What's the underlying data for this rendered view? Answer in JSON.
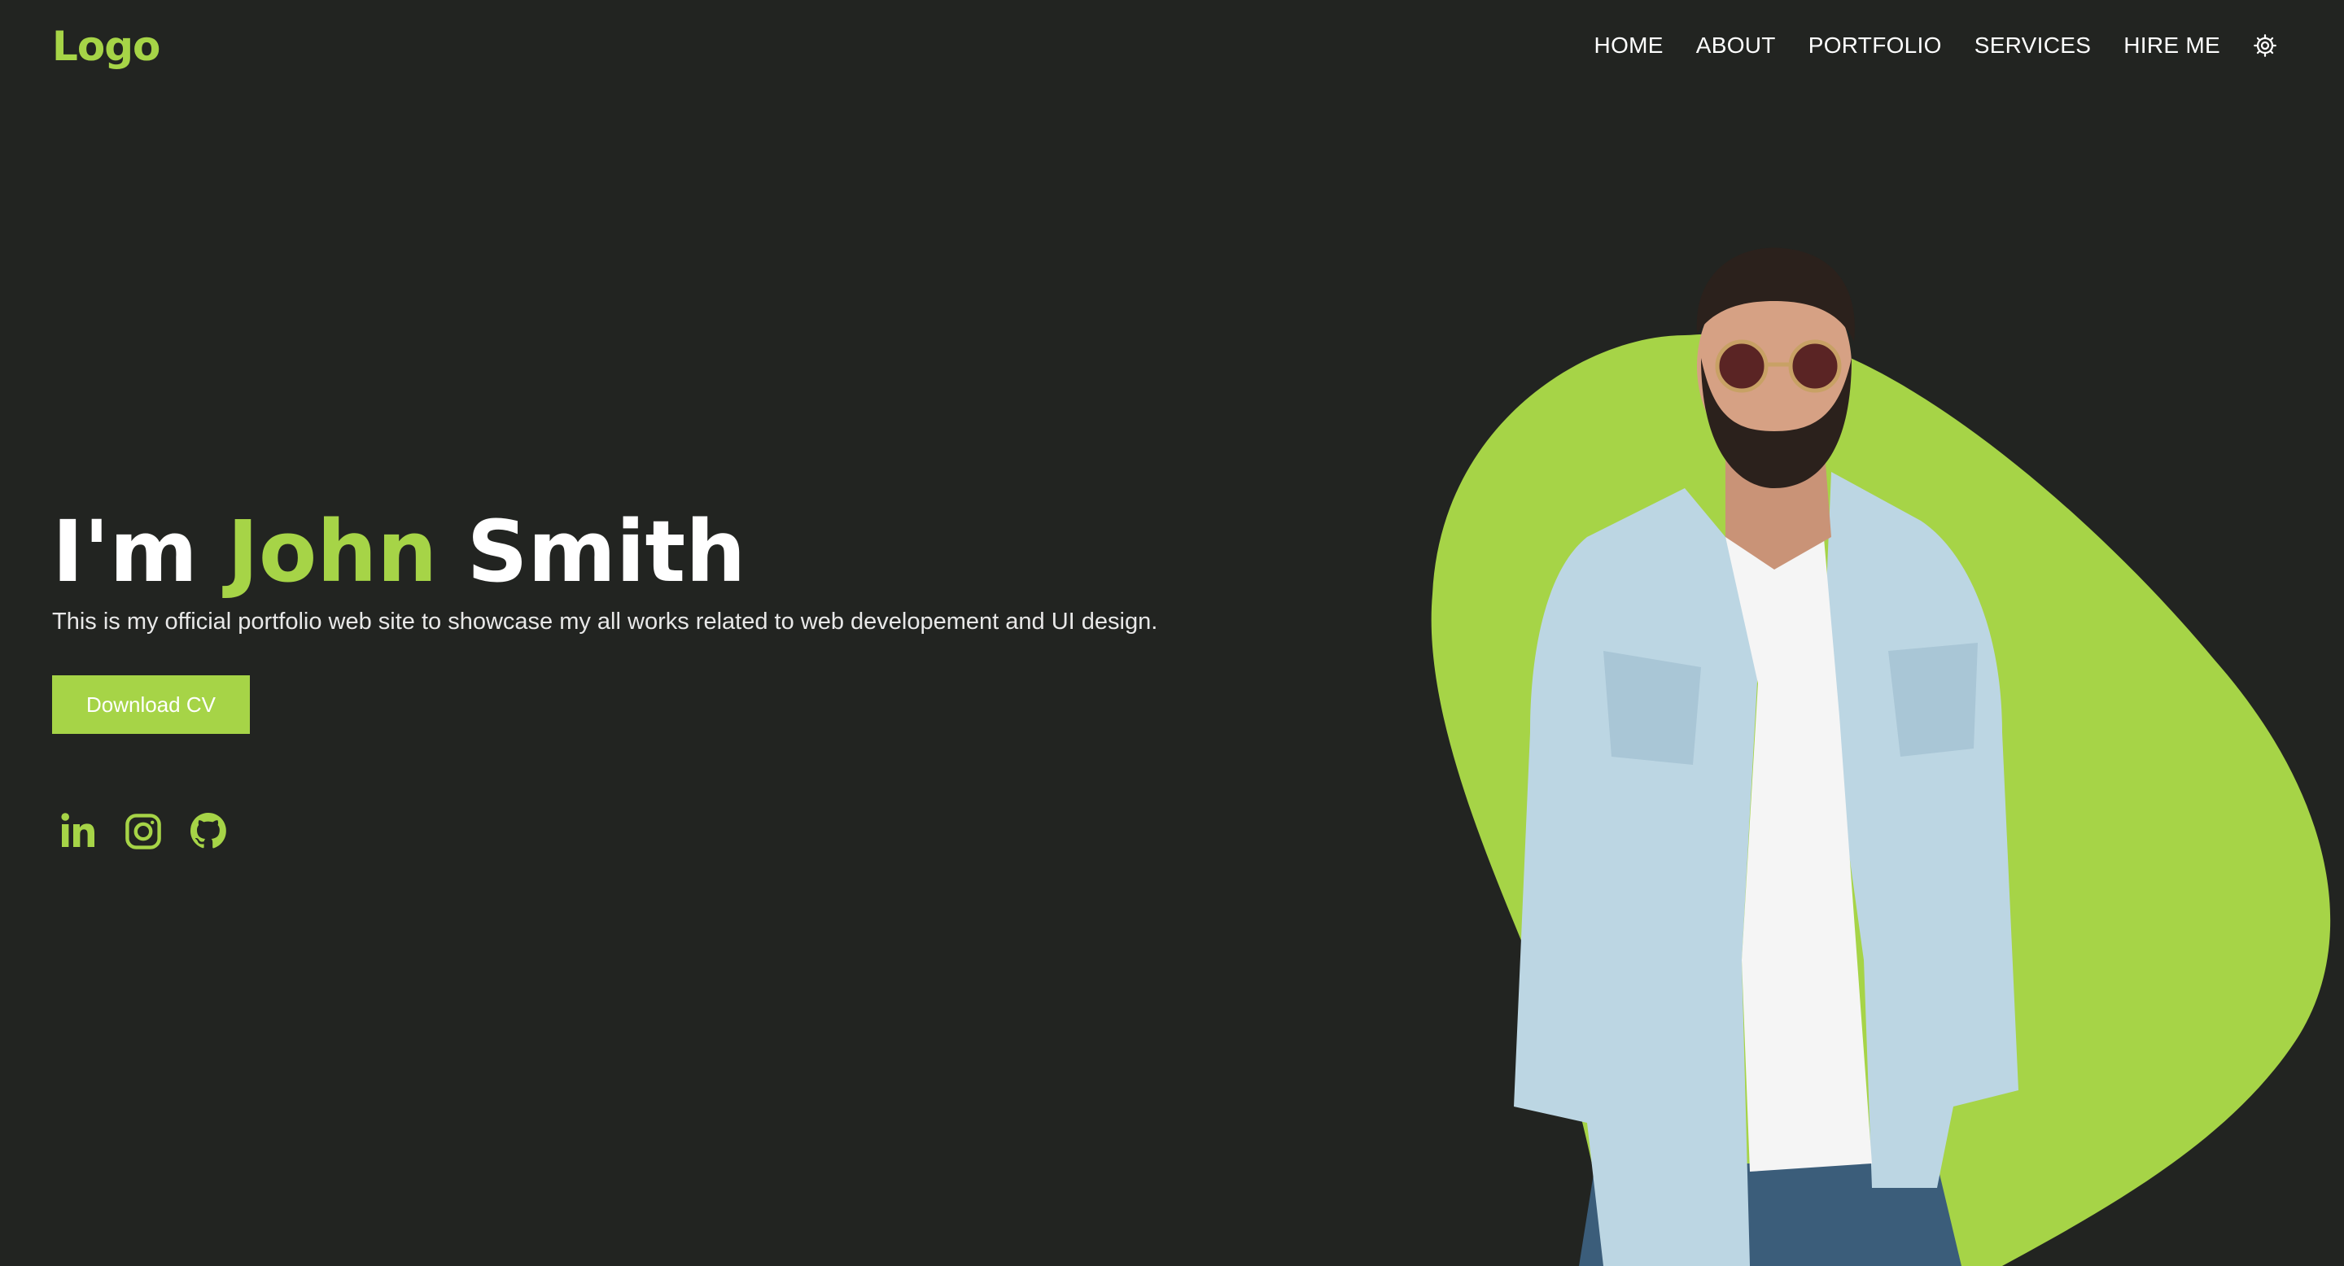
{
  "header": {
    "logo": "Logo",
    "nav": [
      {
        "label": "HOME"
      },
      {
        "label": "ABOUT"
      },
      {
        "label": "PORTFOLIO"
      },
      {
        "label": "SERVICES"
      },
      {
        "label": "HIRE ME"
      }
    ],
    "settings_icon": "gear-icon"
  },
  "hero": {
    "title_prefix": "I'm",
    "title_first_name": "John",
    "title_last_name": "Smith",
    "subtitle": "This is my official portfolio web site to showcase my all works related to web developement and UI design.",
    "cta_label": "Download CV"
  },
  "social_links": [
    {
      "icon": "linkedin-icon"
    },
    {
      "icon": "instagram-icon"
    },
    {
      "icon": "github-icon"
    }
  ],
  "colors": {
    "background": "#222421",
    "accent": "#a6d447",
    "text": "#ffffff"
  }
}
